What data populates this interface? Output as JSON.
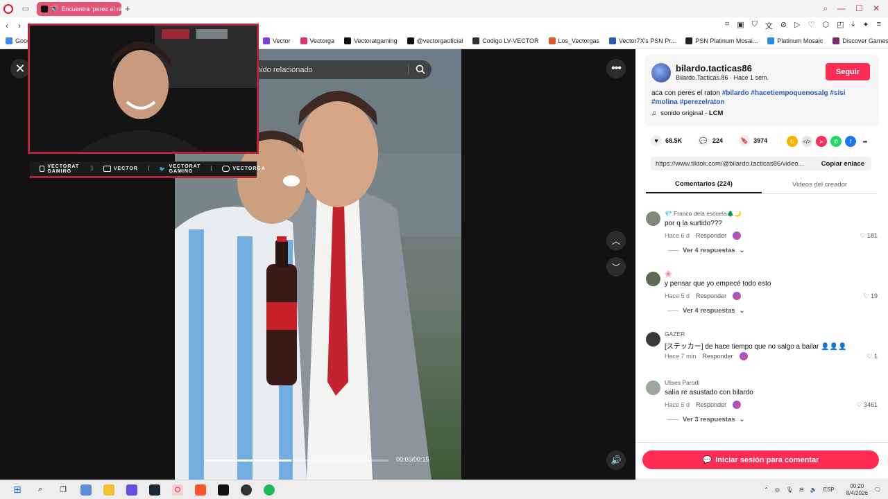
{
  "browser": {
    "tab_title": "Encuentra 'perez el rat",
    "bookmarks": [
      {
        "label": "Goog",
        "color": "#4285f4"
      },
      {
        "label": "Vector",
        "color": "#7b3fe4"
      },
      {
        "label": "Vectorga",
        "color": "#e1306c"
      },
      {
        "label": "Vectoratgaming",
        "color": "#111111"
      },
      {
        "label": "@vectorgaoficial",
        "color": "#111111"
      },
      {
        "label": "Codigo LV-VECTOR",
        "color": "#333333"
      },
      {
        "label": "Los_Vectorgas",
        "color": "#e0582a"
      },
      {
        "label": "Vector7X's PSN Pr...",
        "color": "#2a5db0"
      },
      {
        "label": "PSN Platinum Mosai...",
        "color": "#222222"
      },
      {
        "label": "Platinum Mosaic",
        "color": "#2a8be0"
      },
      {
        "label": "Discover Games -...",
        "color": "#7a2f6b"
      }
    ]
  },
  "video": {
    "search_placeholder": "nido relacionado",
    "time": "00:00/00:15",
    "progress": 0.47
  },
  "overlay": {
    "youtube": "VECTORAT GAMING",
    "twitch": "VECTOR",
    "twitter": "VECTORAT GAMING",
    "instagram": "VECTORGA"
  },
  "author": {
    "username": "bilardo.tacticas86",
    "display": "Bilardo.Tacticas.86 · Hace 1 sem.",
    "follow_label": "Seguir",
    "description_text": "aca con peres el raton",
    "hashtags": [
      "#bilardo",
      "#hacetiempoquenosalg",
      "#sisi",
      "#molina",
      "#perezelraton"
    ],
    "sound": "sonido original - ",
    "sound_author": "LCM"
  },
  "stats": {
    "likes": "68.5K",
    "comments": "224",
    "saves": "3974"
  },
  "link": {
    "url": "https://www.tiktok.com/@bilardo.tacticas86/video...",
    "copy_label": "Copiar enlace"
  },
  "tabs": {
    "comments": "Comentarios (224)",
    "creator": "Videos del creador"
  },
  "comments": [
    {
      "user": "💎 Franco dela escuela🌲🌙",
      "text": "por q la surtido???",
      "time": "Hace 6 d",
      "reply": "Responder",
      "likes": "181",
      "replies": "Ver 4 respuestas",
      "avatar": "#7f8a7a"
    },
    {
      "user": "🌸",
      "text": "y pensar que yo empecé todo esto",
      "time": "Hace 5 d",
      "reply": "Responder",
      "likes": "19",
      "replies": "Ver 4 respuestas",
      "avatar": "#5d6b52"
    },
    {
      "user": "GAZER",
      "text": "[ステッカー] de hace tiempo que no salgo a bailar 👤👤👤",
      "time": "Hace 7 min",
      "reply": "Responder",
      "likes": "1",
      "replies": "",
      "avatar": "#3a3a3a"
    },
    {
      "user": "Ulises Parodi",
      "text": "salía re asustado con bilardo",
      "time": "Hace 6 d",
      "reply": "Responder",
      "likes": "3461",
      "replies": "Ver 3 respuestas",
      "avatar": "#9aa89a"
    }
  ],
  "footer": {
    "login_label": "Iniciar sesión para comentar"
  },
  "taskbar": {
    "lang": "ESP",
    "time": "00:20",
    "date": "8/4/2026"
  }
}
